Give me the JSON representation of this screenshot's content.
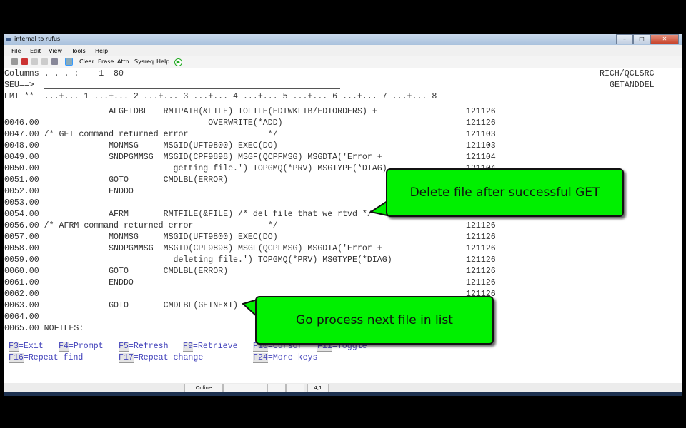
{
  "window": {
    "title": "internal to rufus",
    "controls": [
      "minimize",
      "maximize",
      "close"
    ]
  },
  "menu": [
    "File",
    "Edit",
    "View",
    "Tools",
    "Help"
  ],
  "toolbar": {
    "buttons": [
      "Clear",
      "Erase",
      "Attn",
      "Sysreq",
      "Help"
    ],
    "icons": [
      "display-icon",
      "disconnect-icon",
      "copy-icon",
      "paste-icon",
      "print-icon",
      "macro-icon",
      "play-icon"
    ]
  },
  "header": {
    "columns": "Columns . . . :    1  80",
    "library": "RICH/QCLSRC",
    "seu": "SEU==>",
    "member": "GETANDDEL",
    "fmt": "FMT **  ...+... 1 ...+... 2 ...+... 3 ...+... 4 ...+... 5 ...+... 6 ...+... 7 ...+... 8"
  },
  "lines": [
    {
      "text": "                     AFGETDBF   RMTPATH(&FILE) TOFILE(EDIWKLIB/EDIORDERS) +",
      "date": "121126"
    },
    {
      "text": "0046.00                                  OVERWRITE(*ADD)",
      "date": "121126"
    },
    {
      "text": "0047.00 /* GET command returned error                */",
      "date": "121103"
    },
    {
      "text": "0048.00              MONMSG     MSGID(UFT9800) EXEC(DO)",
      "date": "121103"
    },
    {
      "text": "0049.00              SNDPGMMSG  MSGID(CPF9898) MSGF(QCPFMSG) MSGDTA('Error +",
      "date": "121104"
    },
    {
      "text": "0050.00                           getting file.') TOPGMQ(*PRV) MSGTYPE(*DIAG)",
      "date": "121104"
    },
    {
      "text": "0051.00              GOTO       CMDLBL(ERROR)",
      "date": ""
    },
    {
      "text": "0052.00              ENDDO",
      "date": ""
    },
    {
      "text": "0053.00",
      "date": ""
    },
    {
      "text": "0054.00              AFRM       RMTFILE(&FILE) /* del file that we rtvd */",
      "date": ""
    },
    {
      "text": "0056.00 /* AFRM command returned error               */",
      "date": "121126"
    },
    {
      "text": "0057.00              MONMSG     MSGID(UFT9800) EXEC(DO)",
      "date": "121126"
    },
    {
      "text": "0058.00              SNDPGMMSG  MSGID(CPF9898) MSGF(QCPFMSG) MSGDTA('Error +",
      "date": "121126"
    },
    {
      "text": "0059.00                           deleting file.') TOPGMQ(*PRV) MSGTYPE(*DIAG)",
      "date": "121126"
    },
    {
      "text": "0060.00              GOTO       CMDLBL(ERROR)",
      "date": "121126"
    },
    {
      "text": "0061.00              ENDDO",
      "date": "121126"
    },
    {
      "text": "0062.00",
      "date": "121126"
    },
    {
      "text": "0063.00              GOTO       CMDLBL(GETNEXT)",
      "date": ""
    },
    {
      "text": "0064.00",
      "date": ""
    },
    {
      "text": "0065.00 NOFILES:",
      "date": ""
    }
  ],
  "fkeys": [
    {
      "key": "F3",
      "label": "=Exit"
    },
    {
      "key": "F4",
      "label": "=Prompt"
    },
    {
      "key": "F5",
      "label": "=Refresh"
    },
    {
      "key": "F9",
      "label": "=Retrieve"
    },
    {
      "key": "F10",
      "label": "=Cursor"
    },
    {
      "key": "F11",
      "label": "=Toggle"
    },
    {
      "key": "F16",
      "label": "=Repeat find"
    },
    {
      "key": "F17",
      "label": "=Repeat change"
    },
    {
      "key": "F24",
      "label": "=More keys"
    }
  ],
  "status": {
    "state": "Online",
    "cursor": "4,1"
  },
  "callouts": {
    "delete": "Delete file after successful GET",
    "next": "Go process next file in list",
    "color": "#00f000"
  }
}
